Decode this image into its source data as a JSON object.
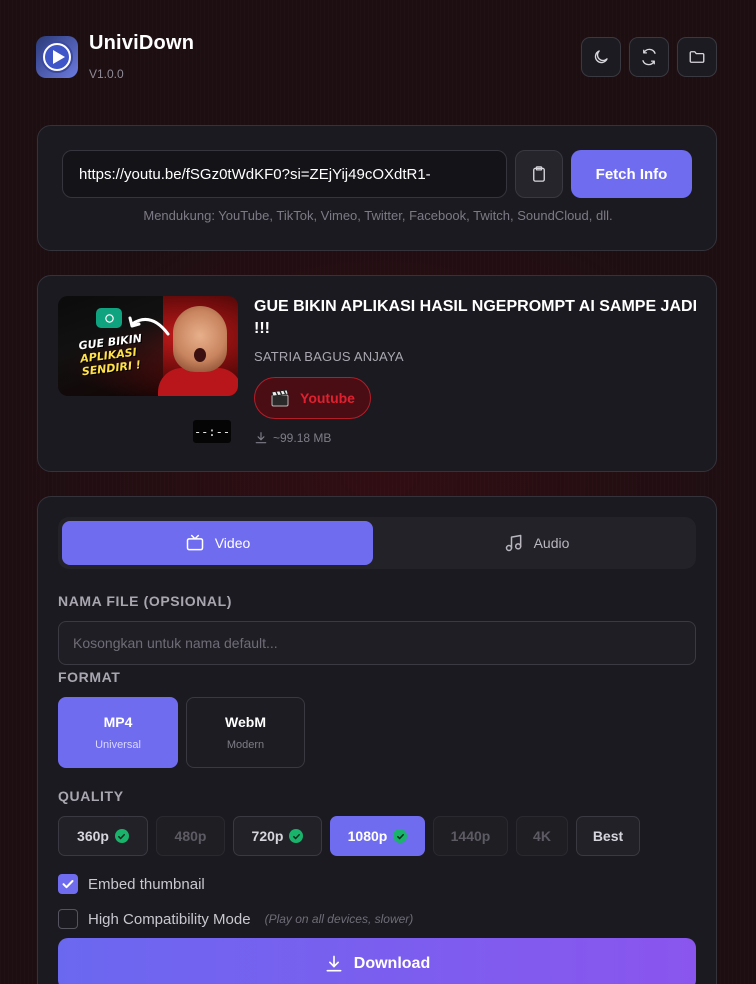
{
  "header": {
    "app_name": "UniviDown",
    "version": "V1.0.0",
    "buttons": [
      "moon-icon",
      "refresh-icon",
      "folder-icon"
    ]
  },
  "url_card": {
    "url_value": "https://youtu.be/fSGz0tWdKF0?si=ZEjYij49cOXdtR1-",
    "fetch_label": "Fetch Info",
    "support_text": "Mendukung: YouTube, TikTok, Vimeo, Twitter, Facebook, Twitch, SoundCloud, dll."
  },
  "video": {
    "title": "GUE BIKIN APLIKASI HASIL NGEPROMPT AI SAMPE JADI !!!",
    "channel": "SATRIA BAGUS ANJAYA",
    "duration": "--:--",
    "platform": "Youtube",
    "size": "~99.18 MB",
    "thumbnail_text": {
      "line1": "GUE BIKIN",
      "line2": "APLIKASI",
      "line3": "SENDIRI !"
    }
  },
  "options": {
    "tabs": [
      {
        "label": "Video",
        "icon": "tv-icon",
        "active": true
      },
      {
        "label": "Audio",
        "icon": "music-icon",
        "active": false
      }
    ],
    "filename_label": "NAMA FILE (OPSIONAL)",
    "filename_placeholder": "Kosongkan untuk nama default...",
    "format_label": "FORMAT",
    "formats": [
      {
        "name": "MP4",
        "sub": "Universal",
        "selected": true
      },
      {
        "name": "WebM",
        "sub": "Modern",
        "selected": false
      }
    ],
    "quality_label": "QUALITY",
    "qualities": [
      {
        "label": "360p",
        "available": true,
        "selected": false
      },
      {
        "label": "480p",
        "available": false,
        "selected": false
      },
      {
        "label": "720p",
        "available": true,
        "selected": false
      },
      {
        "label": "1080p",
        "available": true,
        "selected": true
      },
      {
        "label": "1440p",
        "available": false,
        "selected": false
      },
      {
        "label": "4K",
        "available": false,
        "selected": false
      },
      {
        "label": "Best",
        "available": true,
        "selected": false
      }
    ],
    "embed_thumbnail": {
      "label": "Embed thumbnail",
      "checked": true
    },
    "high_compat": {
      "label": "High Compatibility Mode",
      "hint": "(Play on all devices, slower)",
      "checked": false
    },
    "download_label": "Download"
  },
  "colors": {
    "accent": "#6f6cf0",
    "youtube_red": "#e02030",
    "check_green": "#19b36b"
  }
}
